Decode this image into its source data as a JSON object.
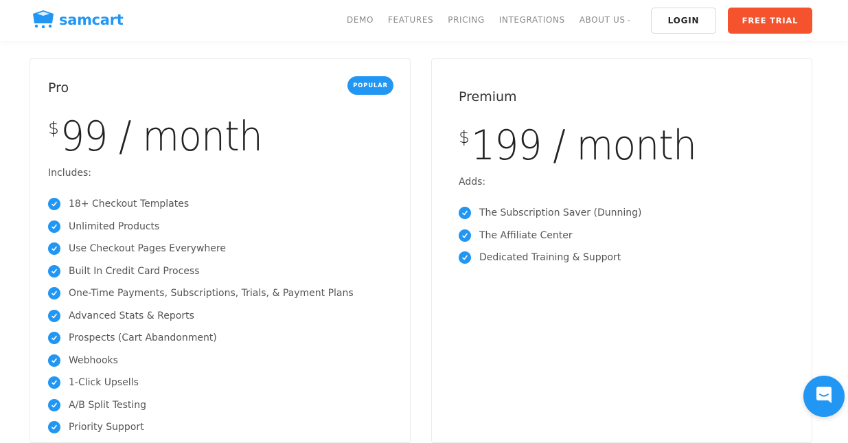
{
  "header": {
    "logo_text": "samcart",
    "nav": [
      {
        "label": "DEMO"
      },
      {
        "label": "FEATURES"
      },
      {
        "label": "PRICING"
      },
      {
        "label": "INTEGRATIONS"
      },
      {
        "label": "ABOUT US",
        "has_dropdown": true
      }
    ],
    "login_label": "LOGIN",
    "trial_label": "FREE TRIAL"
  },
  "colors": {
    "brand_blue": "#2196f3",
    "cta_orange": "#f5532d"
  },
  "plans": [
    {
      "name": "Pro",
      "badge": "POPULAR",
      "currency": "$",
      "price": "99 / month",
      "section_label": "Includes:",
      "features": [
        "18+ Checkout Templates",
        "Unlimited Products",
        "Use Checkout Pages Everywhere",
        "Built In Credit Card Process",
        "One-Time Payments, Subscriptions, Trials, & Payment Plans",
        "Advanced Stats & Reports",
        "Prospects (Cart Abandonment)",
        "Webhooks",
        "1-Click Upsells",
        "A/B Split Testing",
        "Priority Support"
      ]
    },
    {
      "name": "Premium",
      "currency": "$",
      "price": "199 / month",
      "section_label": "Adds:",
      "features": [
        "The Subscription Saver (Dunning)",
        "The Affiliate Center",
        "Dedicated Training & Support"
      ]
    }
  ],
  "chat_widget": {
    "icon": "chat-bubble-icon"
  }
}
